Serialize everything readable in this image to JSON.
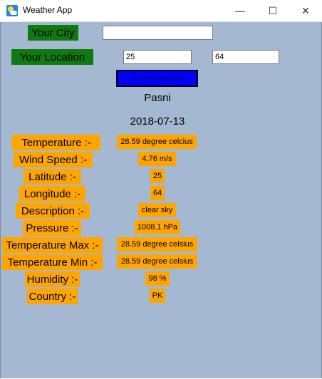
{
  "window": {
    "title": "Weather App",
    "minimize": "—",
    "maximize": "☐",
    "close": "✕"
  },
  "form": {
    "city_label": "Your City",
    "city_value": "",
    "location_label": "Your Location",
    "latitude_value": "25",
    "longitude_value": "64",
    "show_button": "Show Weather"
  },
  "result": {
    "city": "Pasni",
    "date": "2018-07-13",
    "rows": [
      {
        "label": "Temperature  :-",
        "value": "28.59 degree celcius"
      },
      {
        "label": "Wind Speed  :-",
        "value": "4.76 m/s"
      },
      {
        "label": "Latitude  :-",
        "value": "25"
      },
      {
        "label": "Longitude  :-",
        "value": "64"
      },
      {
        "label": "Description  :-",
        "value": "clear sky"
      },
      {
        "label": "Pressure :-",
        "value": "1008.1 hPa"
      },
      {
        "label": "Temperature Max :-",
        "value": "28.59 degree celsius"
      },
      {
        "label": "Temperature Min :-",
        "value": "28.59 degree celsius"
      },
      {
        "label": "Humidity :-",
        "value": "98 %"
      },
      {
        "label": "Country :-",
        "value": "PK"
      }
    ]
  },
  "colors": {
    "background": "#a4b8d1",
    "green_button": "#0f7a0f",
    "blue_button": "#0000ff",
    "label_orange": "#ffa500"
  }
}
